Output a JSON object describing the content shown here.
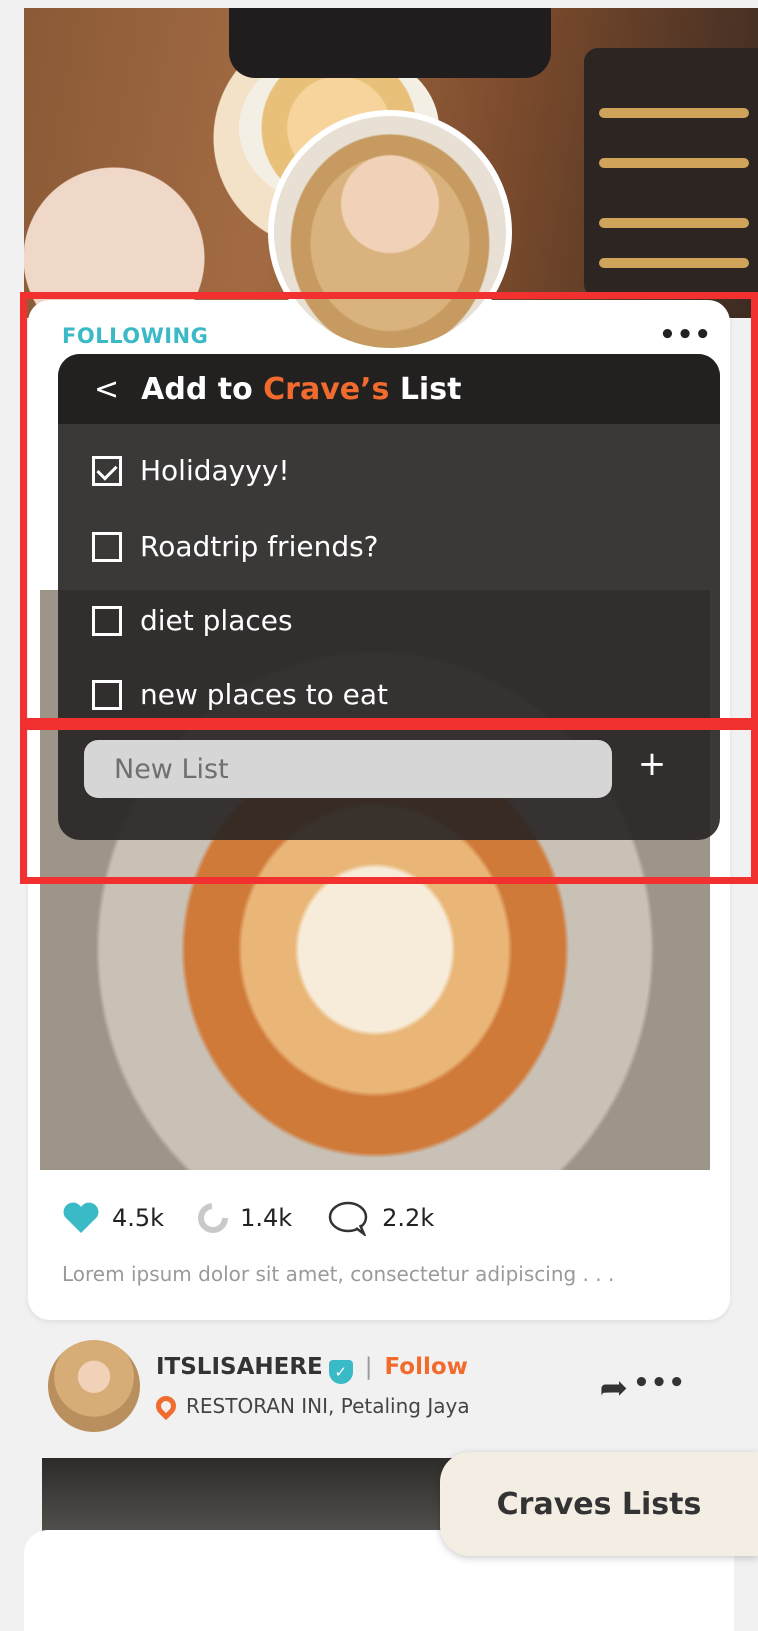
{
  "profile_header": {
    "notch": true
  },
  "feed": {
    "tab_label": "FOLLOWING",
    "post1": {
      "username": "ITSLISAHERE",
      "follow_label": "Follow",
      "location": "RESTORAN INI, Petaling Jaya",
      "likes": "4.5k",
      "recraves": "1.4k",
      "comments": "2.2k",
      "caption": "Lorem ipsum dolor sit amet, consectetur adipiscing . . ."
    },
    "post2": {
      "username": "ITSLISAHERE",
      "follow_label": "Follow",
      "location": "RESTORAN INI, Petaling Jaya"
    }
  },
  "modal": {
    "title_prefix": "Add to ",
    "title_name": "Crave’s",
    "title_suffix": " List",
    "lists": [
      {
        "label": "Holidayyy!",
        "checked": true
      },
      {
        "label": "Roadtrip friends?",
        "checked": false
      },
      {
        "label": "diet places",
        "checked": false
      },
      {
        "label": "new places to eat",
        "checked": false
      }
    ],
    "new_list_placeholder": "New List"
  },
  "floating_button": {
    "label": "Craves Lists"
  },
  "colors": {
    "accent_teal": "#3ab9c6",
    "accent_orange": "#f26b2e",
    "highlight_red": "#f23030"
  }
}
